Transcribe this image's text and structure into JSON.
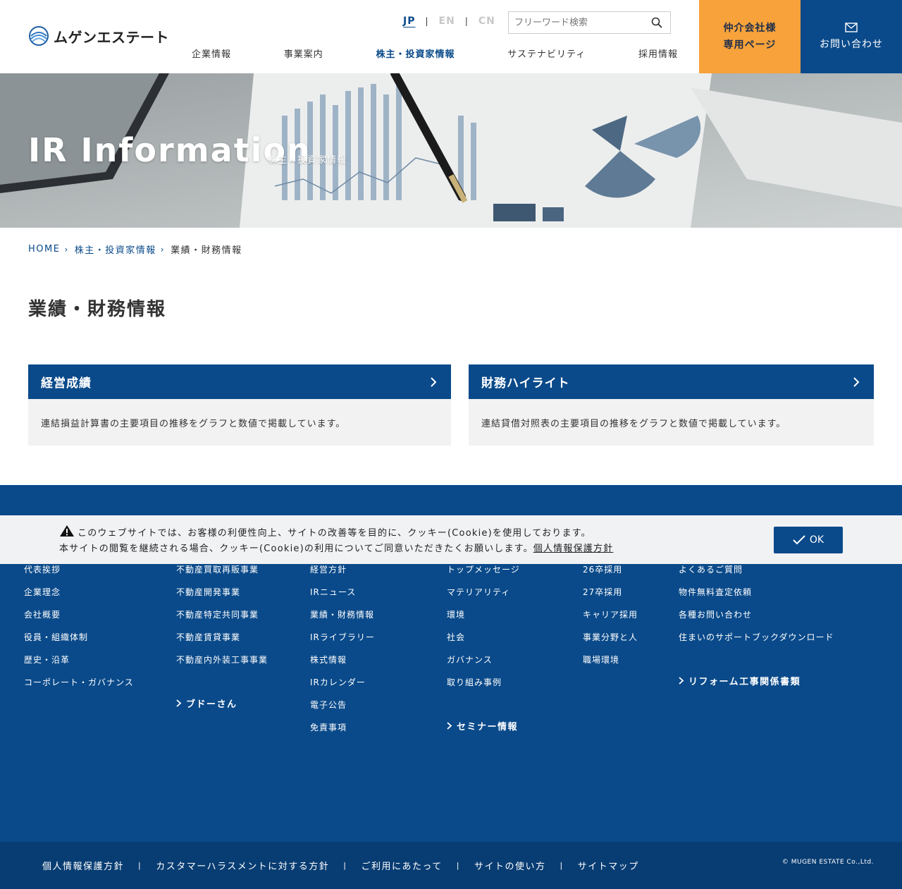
{
  "header": {
    "logo_text": "ムゲンエステート",
    "languages": [
      {
        "label": "JP",
        "active": true
      },
      {
        "label": "EN",
        "active": false
      },
      {
        "label": "CN",
        "active": false
      }
    ],
    "search": {
      "placeholder": "フリーワード検索"
    },
    "nav": [
      "企業情報",
      "事業案内",
      "株主・投資家情報",
      "サステナビリティ",
      "採用情報"
    ],
    "nav_active_index": 2,
    "broker_line1": "仲介会社様",
    "broker_line2": "専用ページ",
    "contact_label": "お問い合わせ"
  },
  "hero": {
    "title": "IR Information",
    "subtitle": "株主・投資家情報"
  },
  "breadcrumb": {
    "home": "HOME",
    "parent": "株主・投資家情報",
    "current": "業績・財務情報"
  },
  "page_title": "業績・財務情報",
  "cards": [
    {
      "title": "経営成績",
      "description": "連結損益計算書の主要項目の推移をグラフと数値で掲載しています。"
    },
    {
      "title": "財務ハイライト",
      "description": "連結貸借対照表の主要項目の推移をグラフと数値で掲載しています。"
    }
  ],
  "cookie": {
    "line1": "このウェブサイトでは、お客様の利便性向上、サイトの改善等を目的に、クッキー(Cookie)を使用しております。",
    "line2": "本サイトの閲覧を継続される場合、クッキー(Cookie)の利用についてご同意いただきたくお願いします。",
    "policy_link": "個人情報保護方針",
    "ok_label": "OK"
  },
  "footer": {
    "col1": [
      "代表挨拶",
      "企業理念",
      "会社概要",
      "役員・組織体制",
      "歴史・沿革",
      "コーポレート・ガバナンス"
    ],
    "col2": [
      "不動産買取再販事業",
      "不動産開発事業",
      "不動産特定共同事業",
      "不動産賃貸事業",
      "不動産内外装工事事業"
    ],
    "col2_heading": "ブドーさん",
    "col3": [
      "経営方針",
      "IRニュース",
      "業績・財務情報",
      "IRライブラリー",
      "株式情報",
      "IRカレンダー",
      "電子公告",
      "免責事項"
    ],
    "col4": [
      "トップメッセージ",
      "マテリアリティ",
      "環境",
      "社会",
      "ガバナンス",
      "取り組み事例"
    ],
    "col4_heading": "セミナー情報",
    "col5": [
      "26卒採用",
      "27卒採用",
      "キャリア採用",
      "事業分野と人",
      "職場環境"
    ],
    "col6": [
      "よくあるご質問",
      "物件無料査定依頼",
      "各種お問い合わせ",
      "住まいのサポートブックダウンロード"
    ],
    "col6_heading": "リフォーム工事関係書類",
    "bottom_links": [
      "個人情報保護方針",
      "カスタマーハラスメントに対する方針",
      "ご利用にあたって",
      "サイトの使い方",
      "サイトマップ"
    ],
    "copyright": "© MUGEN ESTATE Co.,Ltd."
  }
}
